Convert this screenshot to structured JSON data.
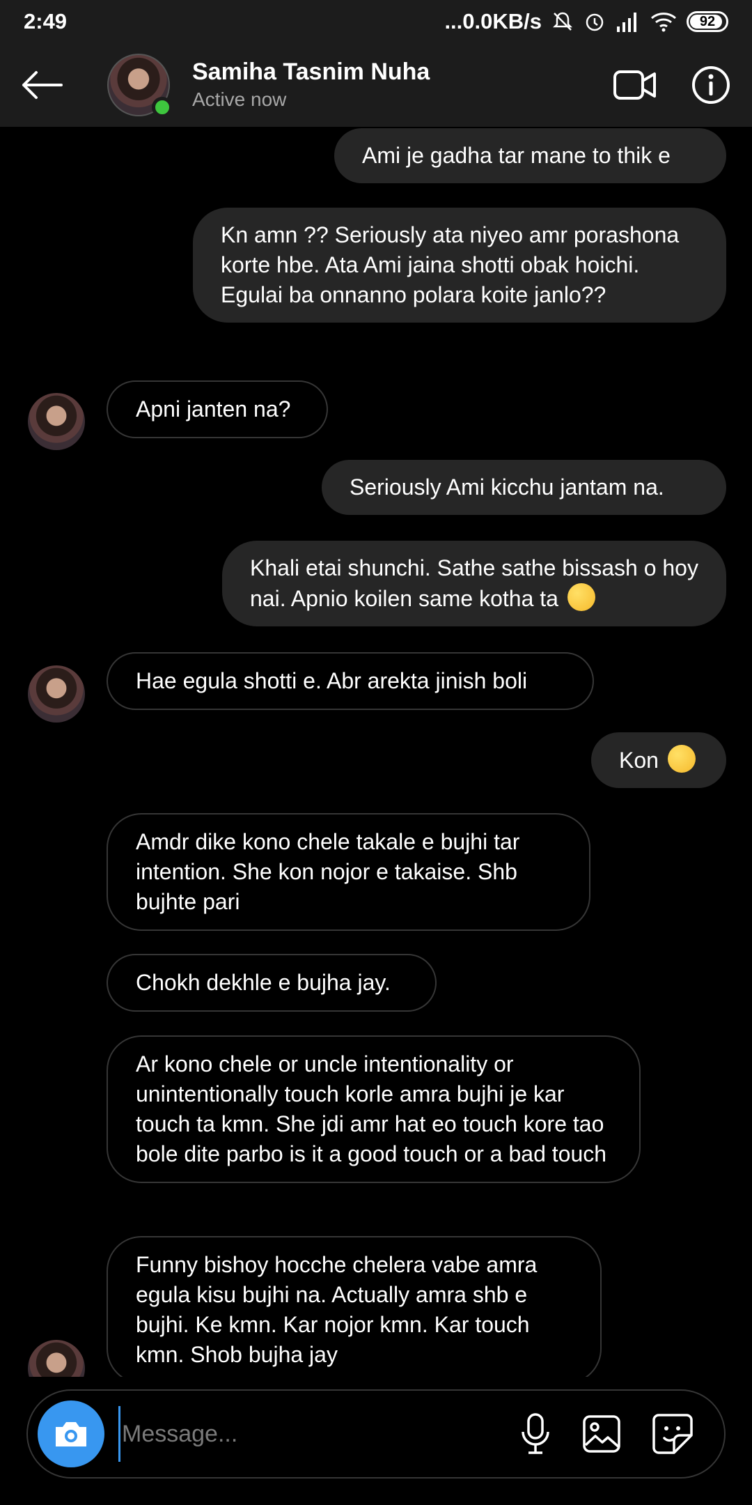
{
  "status_bar": {
    "time": "2:49",
    "network_speed": "...0.0KB/s",
    "battery": "92",
    "icons": [
      "mute-icon",
      "alarm-icon",
      "signal-icon",
      "wifi-icon",
      "battery-icon"
    ]
  },
  "header": {
    "name": "Samiha Tasnim Nuha",
    "status": "Active now",
    "online_color": "#3ec63e"
  },
  "messages": [
    {
      "dir": "out",
      "text": "Ami je gadha tar mane to thik e"
    },
    {
      "dir": "out",
      "text": "Kn amn ?? Seriously ata niyeo amr porashona korte hbe. Ata Ami jaina shotti obak hoichi. Egulai ba onnanno polara koite janlo??"
    },
    {
      "dir": "in",
      "text": "Apni janten na?"
    },
    {
      "dir": "out",
      "text": "Seriously Ami kicchu jantam na."
    },
    {
      "dir": "out",
      "text": "Khali etai shunchi. Sathe sathe bissash o hoy nai. Apnio koilen same kotha ta",
      "emoji": "woozy-face"
    },
    {
      "dir": "in",
      "text": "Hae egula shotti e. Abr arekta jinish boli"
    },
    {
      "dir": "out",
      "text": "Kon",
      "emoji": "slightly-smiling-face"
    },
    {
      "dir": "in",
      "text": "Amdr dike kono chele takale e bujhi tar intention. She kon nojor e takaise. Shb bujhte pari"
    },
    {
      "dir": "in",
      "text": "Chokh dekhle e bujha jay."
    },
    {
      "dir": "in",
      "text": "Ar kono chele or uncle intentionality or unintentionally touch korle amra bujhi je kar touch ta kmn. She jdi amr hat eo touch kore tao bole dite parbo is it a good touch or a bad touch"
    },
    {
      "dir": "in",
      "text": "Funny bishoy hocche chelera vabe amra egula kisu bujhi na. Actually amra shb e bujhi. Ke kmn. Kar nojor kmn. Kar touch kmn. Shob bujha jay"
    }
  ],
  "composer": {
    "placeholder": "Message...",
    "accent": "#3897f0",
    "icons": [
      "camera-icon",
      "microphone-icon",
      "gallery-icon",
      "sticker-icon"
    ]
  },
  "colors": {
    "background": "#000000",
    "bar": "#1c1c1c",
    "outgoing_bubble": "#262626",
    "incoming_border": "#363636"
  }
}
